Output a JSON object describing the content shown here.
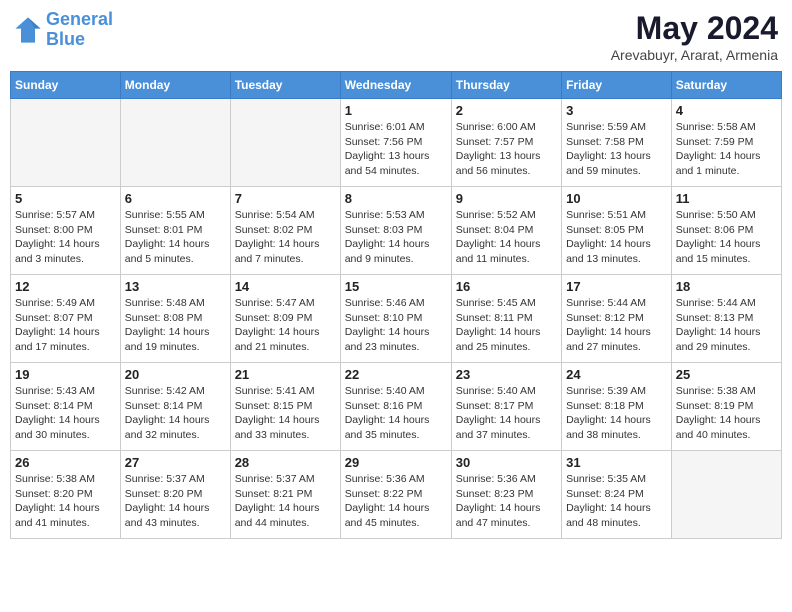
{
  "logo": {
    "line1": "General",
    "line2": "Blue"
  },
  "title": {
    "month_year": "May 2024",
    "location": "Arevabuyr, Ararat, Armenia"
  },
  "weekdays": [
    "Sunday",
    "Monday",
    "Tuesday",
    "Wednesday",
    "Thursday",
    "Friday",
    "Saturday"
  ],
  "weeks": [
    [
      {
        "day": "",
        "info": ""
      },
      {
        "day": "",
        "info": ""
      },
      {
        "day": "",
        "info": ""
      },
      {
        "day": "1",
        "info": "Sunrise: 6:01 AM\nSunset: 7:56 PM\nDaylight: 13 hours\nand 54 minutes."
      },
      {
        "day": "2",
        "info": "Sunrise: 6:00 AM\nSunset: 7:57 PM\nDaylight: 13 hours\nand 56 minutes."
      },
      {
        "day": "3",
        "info": "Sunrise: 5:59 AM\nSunset: 7:58 PM\nDaylight: 13 hours\nand 59 minutes."
      },
      {
        "day": "4",
        "info": "Sunrise: 5:58 AM\nSunset: 7:59 PM\nDaylight: 14 hours\nand 1 minute."
      }
    ],
    [
      {
        "day": "5",
        "info": "Sunrise: 5:57 AM\nSunset: 8:00 PM\nDaylight: 14 hours\nand 3 minutes."
      },
      {
        "day": "6",
        "info": "Sunrise: 5:55 AM\nSunset: 8:01 PM\nDaylight: 14 hours\nand 5 minutes."
      },
      {
        "day": "7",
        "info": "Sunrise: 5:54 AM\nSunset: 8:02 PM\nDaylight: 14 hours\nand 7 minutes."
      },
      {
        "day": "8",
        "info": "Sunrise: 5:53 AM\nSunset: 8:03 PM\nDaylight: 14 hours\nand 9 minutes."
      },
      {
        "day": "9",
        "info": "Sunrise: 5:52 AM\nSunset: 8:04 PM\nDaylight: 14 hours\nand 11 minutes."
      },
      {
        "day": "10",
        "info": "Sunrise: 5:51 AM\nSunset: 8:05 PM\nDaylight: 14 hours\nand 13 minutes."
      },
      {
        "day": "11",
        "info": "Sunrise: 5:50 AM\nSunset: 8:06 PM\nDaylight: 14 hours\nand 15 minutes."
      }
    ],
    [
      {
        "day": "12",
        "info": "Sunrise: 5:49 AM\nSunset: 8:07 PM\nDaylight: 14 hours\nand 17 minutes."
      },
      {
        "day": "13",
        "info": "Sunrise: 5:48 AM\nSunset: 8:08 PM\nDaylight: 14 hours\nand 19 minutes."
      },
      {
        "day": "14",
        "info": "Sunrise: 5:47 AM\nSunset: 8:09 PM\nDaylight: 14 hours\nand 21 minutes."
      },
      {
        "day": "15",
        "info": "Sunrise: 5:46 AM\nSunset: 8:10 PM\nDaylight: 14 hours\nand 23 minutes."
      },
      {
        "day": "16",
        "info": "Sunrise: 5:45 AM\nSunset: 8:11 PM\nDaylight: 14 hours\nand 25 minutes."
      },
      {
        "day": "17",
        "info": "Sunrise: 5:44 AM\nSunset: 8:12 PM\nDaylight: 14 hours\nand 27 minutes."
      },
      {
        "day": "18",
        "info": "Sunrise: 5:44 AM\nSunset: 8:13 PM\nDaylight: 14 hours\nand 29 minutes."
      }
    ],
    [
      {
        "day": "19",
        "info": "Sunrise: 5:43 AM\nSunset: 8:14 PM\nDaylight: 14 hours\nand 30 minutes."
      },
      {
        "day": "20",
        "info": "Sunrise: 5:42 AM\nSunset: 8:14 PM\nDaylight: 14 hours\nand 32 minutes."
      },
      {
        "day": "21",
        "info": "Sunrise: 5:41 AM\nSunset: 8:15 PM\nDaylight: 14 hours\nand 33 minutes."
      },
      {
        "day": "22",
        "info": "Sunrise: 5:40 AM\nSunset: 8:16 PM\nDaylight: 14 hours\nand 35 minutes."
      },
      {
        "day": "23",
        "info": "Sunrise: 5:40 AM\nSunset: 8:17 PM\nDaylight: 14 hours\nand 37 minutes."
      },
      {
        "day": "24",
        "info": "Sunrise: 5:39 AM\nSunset: 8:18 PM\nDaylight: 14 hours\nand 38 minutes."
      },
      {
        "day": "25",
        "info": "Sunrise: 5:38 AM\nSunset: 8:19 PM\nDaylight: 14 hours\nand 40 minutes."
      }
    ],
    [
      {
        "day": "26",
        "info": "Sunrise: 5:38 AM\nSunset: 8:20 PM\nDaylight: 14 hours\nand 41 minutes."
      },
      {
        "day": "27",
        "info": "Sunrise: 5:37 AM\nSunset: 8:20 PM\nDaylight: 14 hours\nand 43 minutes."
      },
      {
        "day": "28",
        "info": "Sunrise: 5:37 AM\nSunset: 8:21 PM\nDaylight: 14 hours\nand 44 minutes."
      },
      {
        "day": "29",
        "info": "Sunrise: 5:36 AM\nSunset: 8:22 PM\nDaylight: 14 hours\nand 45 minutes."
      },
      {
        "day": "30",
        "info": "Sunrise: 5:36 AM\nSunset: 8:23 PM\nDaylight: 14 hours\nand 47 minutes."
      },
      {
        "day": "31",
        "info": "Sunrise: 5:35 AM\nSunset: 8:24 PM\nDaylight: 14 hours\nand 48 minutes."
      },
      {
        "day": "",
        "info": ""
      }
    ]
  ]
}
